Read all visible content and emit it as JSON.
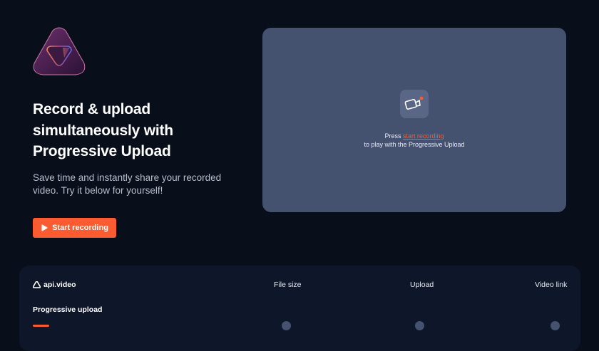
{
  "hero": {
    "headline_lines": [
      "Record & upload",
      "simultaneously with",
      "Progressive Upload"
    ],
    "subtext_lines": [
      "Save time and instantly share your recorded",
      "video. Try it below for yourself!"
    ],
    "start_button_label": "Start recording"
  },
  "preview": {
    "press_text": "Press ",
    "link_text": "start recording",
    "second_line": "to play with the Progressive Upload",
    "icon": "video-camera-icon"
  },
  "table": {
    "brand": "api.video",
    "columns": [
      "File size",
      "Upload",
      "Video link"
    ],
    "rows": [
      {
        "label": "Progressive upload"
      }
    ]
  },
  "colors": {
    "background": "#090e1b",
    "accent": "#fa5b30",
    "panel": "#44516f",
    "table_bg": "#0e1629"
  }
}
